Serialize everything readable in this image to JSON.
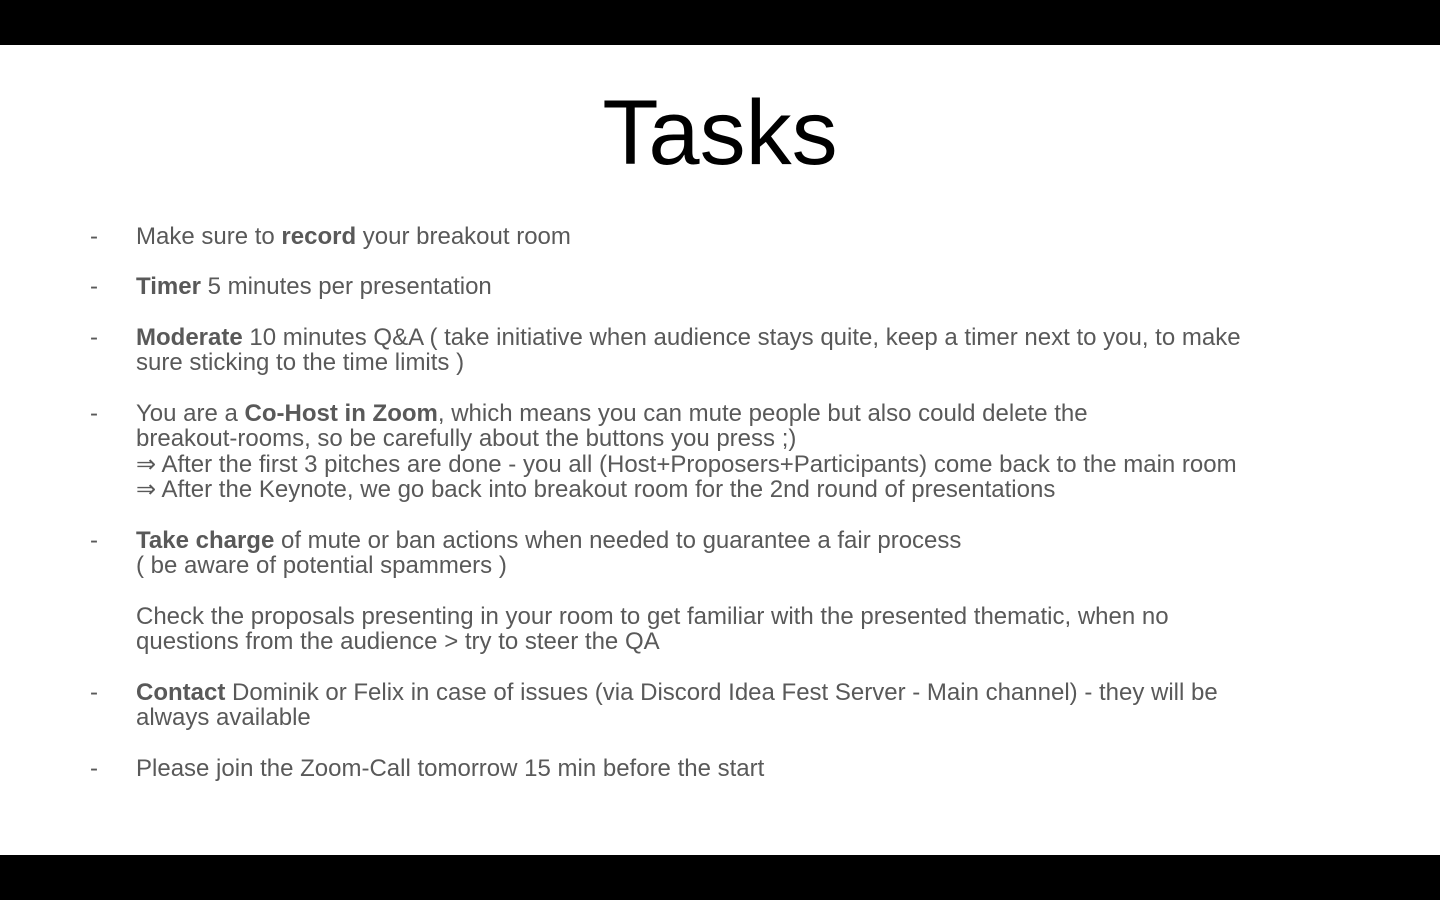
{
  "slide": {
    "title": "Tasks",
    "bullet_marker": "-",
    "items": [
      {
        "has_bullet": true,
        "lines": [
          [
            {
              "t": "Make sure to "
            },
            {
              "t": "record",
              "b": true
            },
            {
              "t": " your breakout room"
            }
          ]
        ]
      },
      {
        "has_bullet": true,
        "lines": [
          [
            {
              "t": "Timer",
              "b": true
            },
            {
              "t": " 5 minutes per presentation"
            }
          ]
        ]
      },
      {
        "has_bullet": true,
        "lines": [
          [
            {
              "t": "Moderate",
              "b": true
            },
            {
              "t": " 10 minutes Q&A ( take initiative when audience stays quite, keep a timer next to you, to make"
            }
          ],
          [
            {
              "t": "sure sticking to the time limits )"
            }
          ]
        ]
      },
      {
        "has_bullet": true,
        "lines": [
          [
            {
              "t": "You are a "
            },
            {
              "t": "Co-Host in Zoom",
              "b": true
            },
            {
              "t": ", which means you can mute people but also could delete the"
            }
          ],
          [
            {
              "t": "breakout-rooms, so be carefully about the buttons you press ;)"
            }
          ],
          [
            {
              "t": "⇒ After the first 3 pitches are done - you all (Host+Proposers+Participants) come back to the main room"
            }
          ],
          [
            {
              "t": "⇒ After the Keynote, we go back into breakout room for the 2nd round of presentations"
            }
          ]
        ]
      },
      {
        "has_bullet": true,
        "lines": [
          [
            {
              "t": "Take charge",
              "b": true
            },
            {
              "t": " of mute or ban actions when needed to guarantee a fair process"
            }
          ],
          [
            {
              "t": "( be aware of potential spammers )"
            }
          ]
        ]
      },
      {
        "has_bullet": false,
        "lines": [
          [
            {
              "t": "Check the proposals presenting in your room to get familiar with the presented thematic, when no"
            }
          ],
          [
            {
              "t": "questions from the audience > try to steer the QA"
            }
          ]
        ]
      },
      {
        "has_bullet": true,
        "lines": [
          [
            {
              "t": "Contact",
              "b": true
            },
            {
              "t": " Dominik or Felix in case of issues (via Discord Idea Fest Server - Main channel) - they will be"
            }
          ],
          [
            {
              "t": "always available"
            }
          ]
        ]
      },
      {
        "has_bullet": true,
        "lines": [
          [
            {
              "t": "Please join the Zoom-Call tomorrow 15 min before the start"
            }
          ]
        ]
      }
    ]
  }
}
